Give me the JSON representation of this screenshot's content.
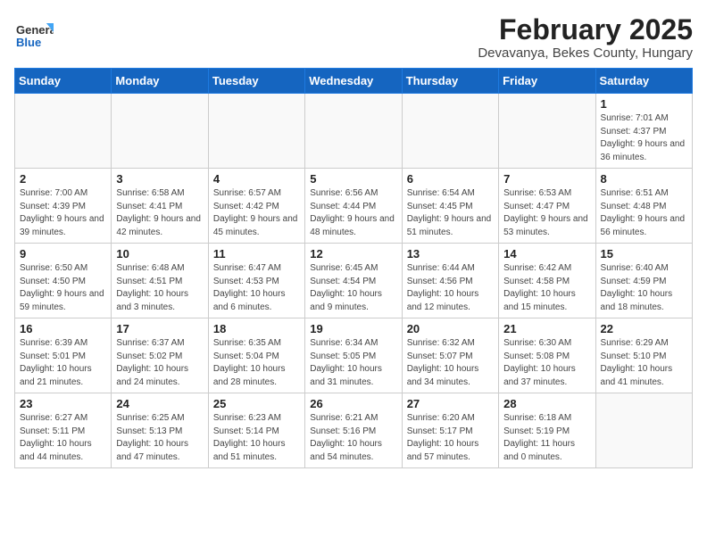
{
  "header": {
    "logo_general": "General",
    "logo_blue": "Blue",
    "month_year": "February 2025",
    "location": "Devavanya, Bekes County, Hungary"
  },
  "weekdays": [
    "Sunday",
    "Monday",
    "Tuesday",
    "Wednesday",
    "Thursday",
    "Friday",
    "Saturday"
  ],
  "weeks": [
    [
      {
        "day": "",
        "info": ""
      },
      {
        "day": "",
        "info": ""
      },
      {
        "day": "",
        "info": ""
      },
      {
        "day": "",
        "info": ""
      },
      {
        "day": "",
        "info": ""
      },
      {
        "day": "",
        "info": ""
      },
      {
        "day": "1",
        "info": "Sunrise: 7:01 AM\nSunset: 4:37 PM\nDaylight: 9 hours and 36 minutes."
      }
    ],
    [
      {
        "day": "2",
        "info": "Sunrise: 7:00 AM\nSunset: 4:39 PM\nDaylight: 9 hours and 39 minutes."
      },
      {
        "day": "3",
        "info": "Sunrise: 6:58 AM\nSunset: 4:41 PM\nDaylight: 9 hours and 42 minutes."
      },
      {
        "day": "4",
        "info": "Sunrise: 6:57 AM\nSunset: 4:42 PM\nDaylight: 9 hours and 45 minutes."
      },
      {
        "day": "5",
        "info": "Sunrise: 6:56 AM\nSunset: 4:44 PM\nDaylight: 9 hours and 48 minutes."
      },
      {
        "day": "6",
        "info": "Sunrise: 6:54 AM\nSunset: 4:45 PM\nDaylight: 9 hours and 51 minutes."
      },
      {
        "day": "7",
        "info": "Sunrise: 6:53 AM\nSunset: 4:47 PM\nDaylight: 9 hours and 53 minutes."
      },
      {
        "day": "8",
        "info": "Sunrise: 6:51 AM\nSunset: 4:48 PM\nDaylight: 9 hours and 56 minutes."
      }
    ],
    [
      {
        "day": "9",
        "info": "Sunrise: 6:50 AM\nSunset: 4:50 PM\nDaylight: 9 hours and 59 minutes."
      },
      {
        "day": "10",
        "info": "Sunrise: 6:48 AM\nSunset: 4:51 PM\nDaylight: 10 hours and 3 minutes."
      },
      {
        "day": "11",
        "info": "Sunrise: 6:47 AM\nSunset: 4:53 PM\nDaylight: 10 hours and 6 minutes."
      },
      {
        "day": "12",
        "info": "Sunrise: 6:45 AM\nSunset: 4:54 PM\nDaylight: 10 hours and 9 minutes."
      },
      {
        "day": "13",
        "info": "Sunrise: 6:44 AM\nSunset: 4:56 PM\nDaylight: 10 hours and 12 minutes."
      },
      {
        "day": "14",
        "info": "Sunrise: 6:42 AM\nSunset: 4:58 PM\nDaylight: 10 hours and 15 minutes."
      },
      {
        "day": "15",
        "info": "Sunrise: 6:40 AM\nSunset: 4:59 PM\nDaylight: 10 hours and 18 minutes."
      }
    ],
    [
      {
        "day": "16",
        "info": "Sunrise: 6:39 AM\nSunset: 5:01 PM\nDaylight: 10 hours and 21 minutes."
      },
      {
        "day": "17",
        "info": "Sunrise: 6:37 AM\nSunset: 5:02 PM\nDaylight: 10 hours and 24 minutes."
      },
      {
        "day": "18",
        "info": "Sunrise: 6:35 AM\nSunset: 5:04 PM\nDaylight: 10 hours and 28 minutes."
      },
      {
        "day": "19",
        "info": "Sunrise: 6:34 AM\nSunset: 5:05 PM\nDaylight: 10 hours and 31 minutes."
      },
      {
        "day": "20",
        "info": "Sunrise: 6:32 AM\nSunset: 5:07 PM\nDaylight: 10 hours and 34 minutes."
      },
      {
        "day": "21",
        "info": "Sunrise: 6:30 AM\nSunset: 5:08 PM\nDaylight: 10 hours and 37 minutes."
      },
      {
        "day": "22",
        "info": "Sunrise: 6:29 AM\nSunset: 5:10 PM\nDaylight: 10 hours and 41 minutes."
      }
    ],
    [
      {
        "day": "23",
        "info": "Sunrise: 6:27 AM\nSunset: 5:11 PM\nDaylight: 10 hours and 44 minutes."
      },
      {
        "day": "24",
        "info": "Sunrise: 6:25 AM\nSunset: 5:13 PM\nDaylight: 10 hours and 47 minutes."
      },
      {
        "day": "25",
        "info": "Sunrise: 6:23 AM\nSunset: 5:14 PM\nDaylight: 10 hours and 51 minutes."
      },
      {
        "day": "26",
        "info": "Sunrise: 6:21 AM\nSunset: 5:16 PM\nDaylight: 10 hours and 54 minutes."
      },
      {
        "day": "27",
        "info": "Sunrise: 6:20 AM\nSunset: 5:17 PM\nDaylight: 10 hours and 57 minutes."
      },
      {
        "day": "28",
        "info": "Sunrise: 6:18 AM\nSunset: 5:19 PM\nDaylight: 11 hours and 0 minutes."
      },
      {
        "day": "",
        "info": ""
      }
    ]
  ]
}
